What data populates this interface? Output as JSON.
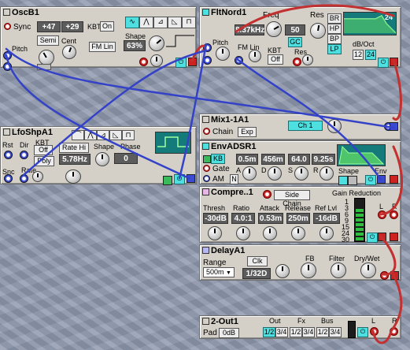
{
  "modules": {
    "osc": {
      "title": "OscB1",
      "sync": "Sync",
      "coarse": "+47",
      "fine": "+29",
      "kbt_label": "KBT",
      "kbt_value": "On",
      "semi": "Semi",
      "cent": "Cent",
      "fm_lin": "FM Lin",
      "pitch": "Pitch",
      "shape_label": "Shape",
      "shape_value": "63%",
      "waves": [
        "sine-wave-icon",
        "triangle-wave-icon",
        "saw-wave-icon",
        "saw-down-wave-icon",
        "square-wave-icon"
      ]
    },
    "filter": {
      "title": "FltNord1",
      "freq_label": "Freq",
      "freq_value": "8.37kHz",
      "res_label": "Res",
      "res_value": "50",
      "gc": "GC",
      "pitch": "Pitch",
      "fm_lin": "FM Lin",
      "kbt_label": "KBT",
      "kbt_value": "Off",
      "res_knob_label": "Res",
      "modes": [
        "BR",
        "HP",
        "BP",
        "LP"
      ],
      "active_mode": "LP",
      "slope_label": "dB/Oct",
      "slopes": [
        "12",
        "24"
      ],
      "active_slope": "24",
      "display_value": "24"
    },
    "mix": {
      "title": "Mix1-1A1",
      "chain": "Chain",
      "exp": "Exp",
      "ch": "Ch 1"
    },
    "lfo": {
      "title": "LfoShpA1",
      "rst": "Rst",
      "dir": "Dir",
      "kbt_label": "KBT",
      "kbt_value": "Off",
      "rate_mode": "Rate Hi",
      "poly": "Poly",
      "rate_value": "5.78Hz",
      "shape_label": "Shape",
      "phase_label": "Phase",
      "phase_value": "0",
      "snc": "Snc",
      "rate_label": "Rate"
    },
    "env": {
      "title": "EnvADSR1",
      "kb": "KB",
      "gate": "Gate",
      "am": "AM",
      "n": "N",
      "a_value": "0.5m",
      "d_value": "456m",
      "s_value": "64.0",
      "r_value": "9.25s",
      "a": "A",
      "d": "D",
      "s": "S",
      "r": "R",
      "shape": "Shape",
      "env": "Env"
    },
    "comp": {
      "title": "Compre..1",
      "side_chain": "Side Chain",
      "gain_reduction": "Gain Reduction",
      "thresh_label": "Thresh",
      "ratio_label": "Ratio",
      "attack_label": "Attack",
      "release_label": "Release",
      "ref_label": "Ref Lvl",
      "thresh": "-30dB",
      "ratio": "4.0:1",
      "attack": "0.53m",
      "release": "250m",
      "ref": "-16dB",
      "scale": [
        "1",
        "3",
        "6",
        "9",
        "15",
        "24",
        "30"
      ],
      "l": "L",
      "r": "R"
    },
    "delay": {
      "title": "DelayA1",
      "range_label": "Range",
      "range_value": "500m",
      "clk": "Clk",
      "time_value": "1/32D",
      "fb": "FB",
      "filter": "Filter",
      "drywet": "Dry/Wet"
    },
    "out": {
      "title": "2-Out1",
      "pad_label": "Pad",
      "pad_value": "0dB",
      "out_label": "Out",
      "fx_label": "Fx",
      "bus_label": "Bus",
      "out_opts": [
        "1/2",
        "3/4"
      ],
      "fx_opts": [
        "1/2",
        "3/4"
      ],
      "bus_opts": [
        "1/2",
        "3/4"
      ],
      "l": "L",
      "r": "R"
    }
  },
  "colors": {
    "panel": "#d4d0c8",
    "display": "#5c5c5c",
    "accent": "#4ee0e0",
    "red_cable": "#c23030",
    "blue_cable": "#3442c8"
  }
}
